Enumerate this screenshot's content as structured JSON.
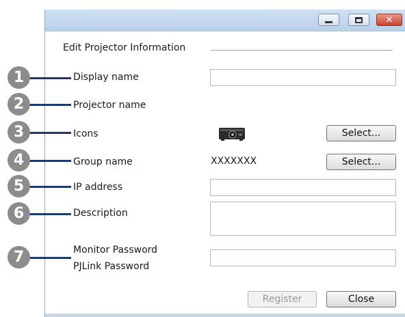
{
  "dialog": {
    "group_title": "Edit Projector Information",
    "labels": {
      "display_name": "Display name",
      "projector_name": "Projector name",
      "icons": "Icons",
      "group_name": "Group name",
      "ip_address": "IP address",
      "description": "Description",
      "monitor_password": "Monitor Password",
      "pjlink_password": "PJLink Password"
    },
    "values": {
      "display_name": "",
      "projector_name": "",
      "group_name": "XXXXXXX",
      "ip_address": "",
      "description": "",
      "password": ""
    },
    "buttons": {
      "select_icon": "Select...",
      "select_group": "Select...",
      "register": "Register",
      "close": "Close"
    },
    "window_controls": {
      "minimize": "minimize-icon",
      "maximize": "maximize-icon",
      "close": "close-icon"
    }
  },
  "callouts": [
    "1",
    "2",
    "3",
    "4",
    "5",
    "6",
    "7"
  ],
  "colors": {
    "titlebar": "#b9d0ea",
    "close_button": "#c8432f",
    "callout": "#8c8c8c",
    "leader_line": "#1b3a6b"
  }
}
